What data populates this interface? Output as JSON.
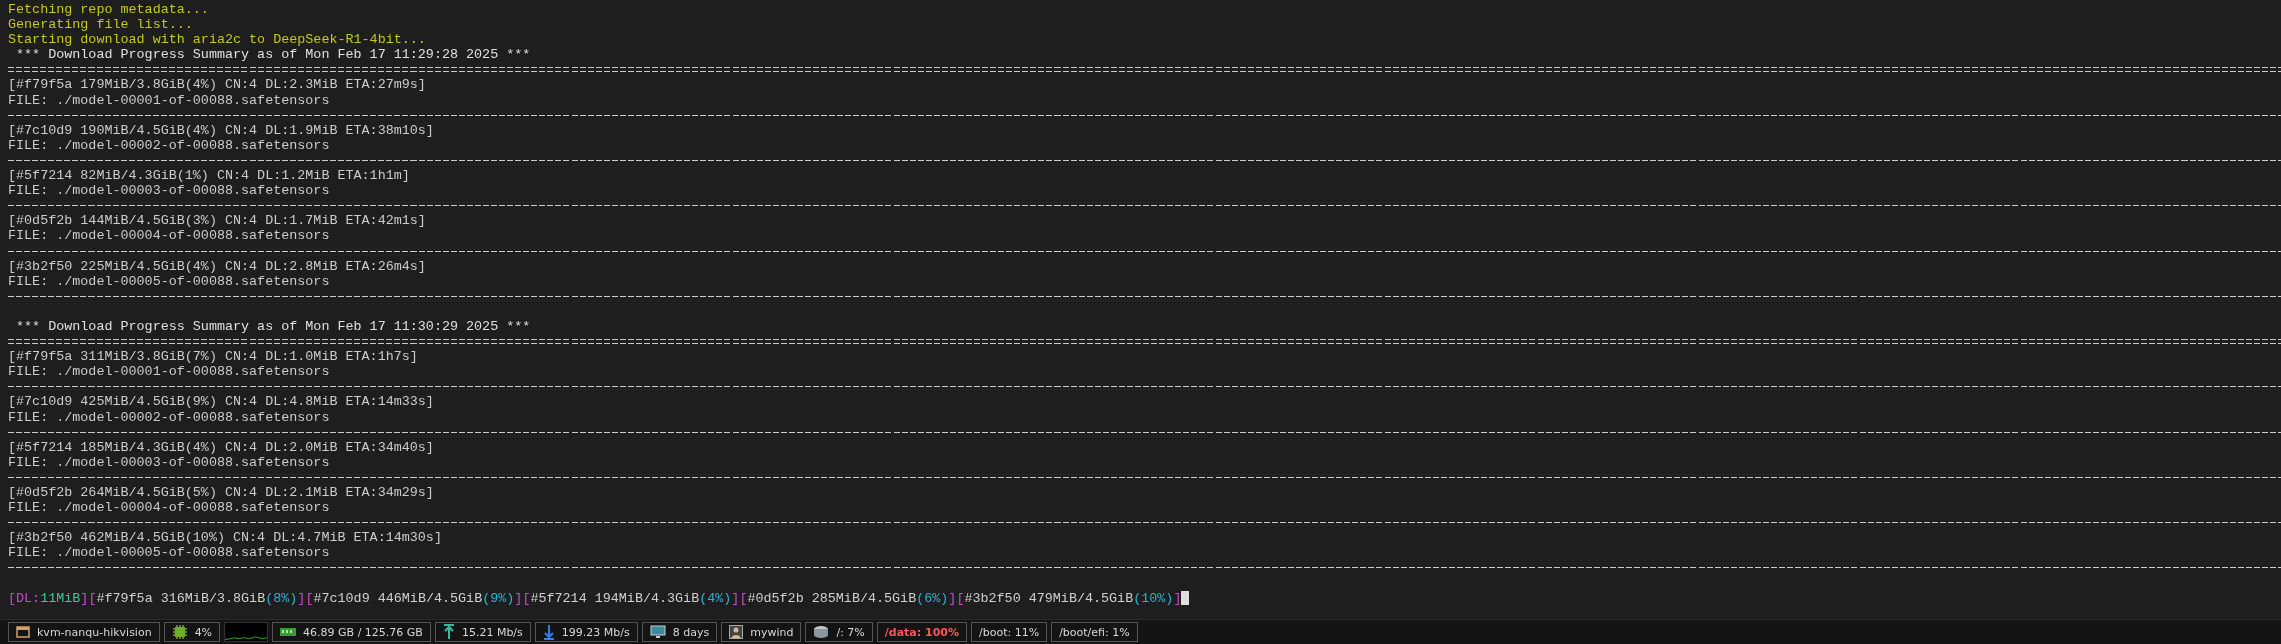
{
  "terminal": {
    "lines": [
      {
        "kind": "status",
        "text": "Fetching repo metadata..."
      },
      {
        "kind": "status",
        "text": "Generating file list..."
      },
      {
        "kind": "status",
        "text": "Starting download with aria2c to DeepSeek-R1-4bit..."
      },
      {
        "kind": "heading",
        "text": " *** Download Progress Summary as of Mon Feb 17 11:29:28 2025 ***"
      },
      {
        "kind": "rule_double"
      },
      {
        "kind": "plain",
        "text": "[#f79f5a 179MiB/3.8GiB(4%) CN:4 DL:2.3MiB ETA:27m9s]"
      },
      {
        "kind": "plain",
        "text": "FILE: ./model-00001-of-00088.safetensors"
      },
      {
        "kind": "rule_single"
      },
      {
        "kind": "plain",
        "text": "[#7c10d9 190MiB/4.5GiB(4%) CN:4 DL:1.9MiB ETA:38m10s]"
      },
      {
        "kind": "plain",
        "text": "FILE: ./model-00002-of-00088.safetensors"
      },
      {
        "kind": "rule_single"
      },
      {
        "kind": "plain",
        "text": "[#5f7214 82MiB/4.3GiB(1%) CN:4 DL:1.2MiB ETA:1h1m]"
      },
      {
        "kind": "plain",
        "text": "FILE: ./model-00003-of-00088.safetensors"
      },
      {
        "kind": "rule_single"
      },
      {
        "kind": "plain",
        "text": "[#0d5f2b 144MiB/4.5GiB(3%) CN:4 DL:1.7MiB ETA:42m1s]"
      },
      {
        "kind": "plain",
        "text": "FILE: ./model-00004-of-00088.safetensors"
      },
      {
        "kind": "rule_single"
      },
      {
        "kind": "plain",
        "text": "[#3b2f50 225MiB/4.5GiB(4%) CN:4 DL:2.8MiB ETA:26m4s]"
      },
      {
        "kind": "plain",
        "text": "FILE: ./model-00005-of-00088.safetensors"
      },
      {
        "kind": "rule_single"
      },
      {
        "kind": "blank"
      },
      {
        "kind": "heading",
        "text": " *** Download Progress Summary as of Mon Feb 17 11:30:29 2025 ***"
      },
      {
        "kind": "rule_double"
      },
      {
        "kind": "plain",
        "text": "[#f79f5a 311MiB/3.8GiB(7%) CN:4 DL:1.0MiB ETA:1h7s]"
      },
      {
        "kind": "plain",
        "text": "FILE: ./model-00001-of-00088.safetensors"
      },
      {
        "kind": "rule_single"
      },
      {
        "kind": "plain",
        "text": "[#7c10d9 425MiB/4.5GiB(9%) CN:4 DL:4.8MiB ETA:14m33s]"
      },
      {
        "kind": "plain",
        "text": "FILE: ./model-00002-of-00088.safetensors"
      },
      {
        "kind": "rule_single"
      },
      {
        "kind": "plain",
        "text": "[#5f7214 185MiB/4.3GiB(4%) CN:4 DL:2.0MiB ETA:34m40s]"
      },
      {
        "kind": "plain",
        "text": "FILE: ./model-00003-of-00088.safetensors"
      },
      {
        "kind": "rule_single"
      },
      {
        "kind": "plain",
        "text": "[#0d5f2b 264MiB/4.5GiB(5%) CN:4 DL:2.1MiB ETA:34m29s]"
      },
      {
        "kind": "plain",
        "text": "FILE: ./model-00004-of-00088.safetensors"
      },
      {
        "kind": "rule_single"
      },
      {
        "kind": "plain",
        "text": "[#3b2f50 462MiB/4.5GiB(10%) CN:4 DL:4.7MiB ETA:14m30s]"
      },
      {
        "kind": "plain",
        "text": "FILE: ./model-00005-of-00088.safetensors"
      },
      {
        "kind": "rule_single"
      },
      {
        "kind": "blank"
      }
    ],
    "progress_line": [
      {
        "text": "[DL:",
        "color": "#c050c8"
      },
      {
        "text": "11MiB",
        "color": "#3cc8a0"
      },
      {
        "text": "]",
        "color": "#c050c8"
      },
      {
        "text": "[",
        "color": "#c050c8"
      },
      {
        "text": "#f79f5a 316MiB/3.8GiB",
        "color": "#d0d0d0"
      },
      {
        "text": "(8%)",
        "color": "#30b0d8"
      },
      {
        "text": "]",
        "color": "#c050c8"
      },
      {
        "text": "[",
        "color": "#c050c8"
      },
      {
        "text": "#7c10d9 446MiB/4.5GiB",
        "color": "#d0d0d0"
      },
      {
        "text": "(9%)",
        "color": "#30b0d8"
      },
      {
        "text": "]",
        "color": "#c050c8"
      },
      {
        "text": "[",
        "color": "#c050c8"
      },
      {
        "text": "#5f7214 194MiB/4.3GiB",
        "color": "#d0d0d0"
      },
      {
        "text": "(4%)",
        "color": "#30b0d8"
      },
      {
        "text": "]",
        "color": "#c050c8"
      },
      {
        "text": "[",
        "color": "#c050c8"
      },
      {
        "text": "#0d5f2b 285MiB/4.5GiB",
        "color": "#d0d0d0"
      },
      {
        "text": "(6%)",
        "color": "#30b0d8"
      },
      {
        "text": "]",
        "color": "#c050c8"
      },
      {
        "text": "[",
        "color": "#c050c8"
      },
      {
        "text": "#3b2f50 479MiB/4.5GiB",
        "color": "#d0d0d0"
      },
      {
        "text": "(10%)",
        "color": "#30b0d8"
      },
      {
        "text": "]",
        "color": "#c050c8"
      }
    ]
  },
  "status_bar": [
    {
      "kind": "host",
      "text": "kvm-nanqu-hikvision",
      "warning": false
    },
    {
      "kind": "cpu",
      "text": "4%",
      "warning": false
    },
    {
      "kind": "graph"
    },
    {
      "kind": "memory",
      "text": "46.89 GB / 125.76 GB",
      "warning": false
    },
    {
      "kind": "upload",
      "text": "15.21 Mb/s",
      "warning": false
    },
    {
      "kind": "download",
      "text": "199.23 Mb/s",
      "warning": false
    },
    {
      "kind": "uptime",
      "text": "8 days",
      "warning": false
    },
    {
      "kind": "user",
      "text": "mywind",
      "warning": false
    },
    {
      "kind": "disk",
      "text": "/: 7%",
      "warning": false
    },
    {
      "kind": "mount",
      "text": "/data: 100%",
      "warning": true
    },
    {
      "kind": "mount",
      "text": "/boot: 11%",
      "warning": false
    },
    {
      "kind": "mount",
      "text": "/boot/efi: 1%",
      "warning": false
    }
  ]
}
